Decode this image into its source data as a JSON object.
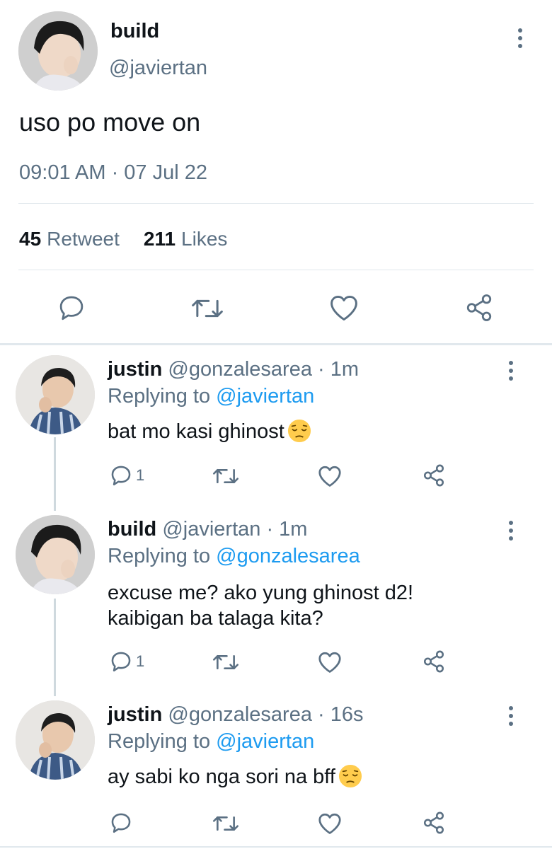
{
  "main_tweet": {
    "display_name": "build",
    "handle": "@javiertan",
    "text": "uso po move on",
    "timestamp": "09:01 AM · 07 Jul 22",
    "retweet_count": "45",
    "retweet_label": "Retweet",
    "like_count": "211",
    "like_label": "Likes"
  },
  "replies": [
    {
      "display_name": "justin",
      "handle_time": "@gonzalesarea · 1m",
      "replying_label": "Replying to",
      "replying_to": "@javiertan",
      "text": "bat mo kasi ghinost",
      "emoji": "pensive-face",
      "reply_count": "1"
    },
    {
      "display_name": "build",
      "handle_time": "@javiertan · 1m",
      "replying_label": "Replying to",
      "replying_to": "@gonzalesarea",
      "text_line1": "excuse me? ako yung ghinost d2!",
      "text_line2": "kaibigan ba talaga kita?",
      "reply_count": "1"
    },
    {
      "display_name": "justin",
      "handle_time": "@gonzalesarea · 16s",
      "replying_label": "Replying to",
      "replying_to": "@javiertan",
      "text": "ay sabi ko nga sori na bff",
      "emoji": "pensive-face",
      "reply_count": ""
    }
  ],
  "colors": {
    "text": "#0f1419",
    "secondary": "#5b7083",
    "link": "#1d9bf0",
    "divider": "#e1e8ed"
  }
}
